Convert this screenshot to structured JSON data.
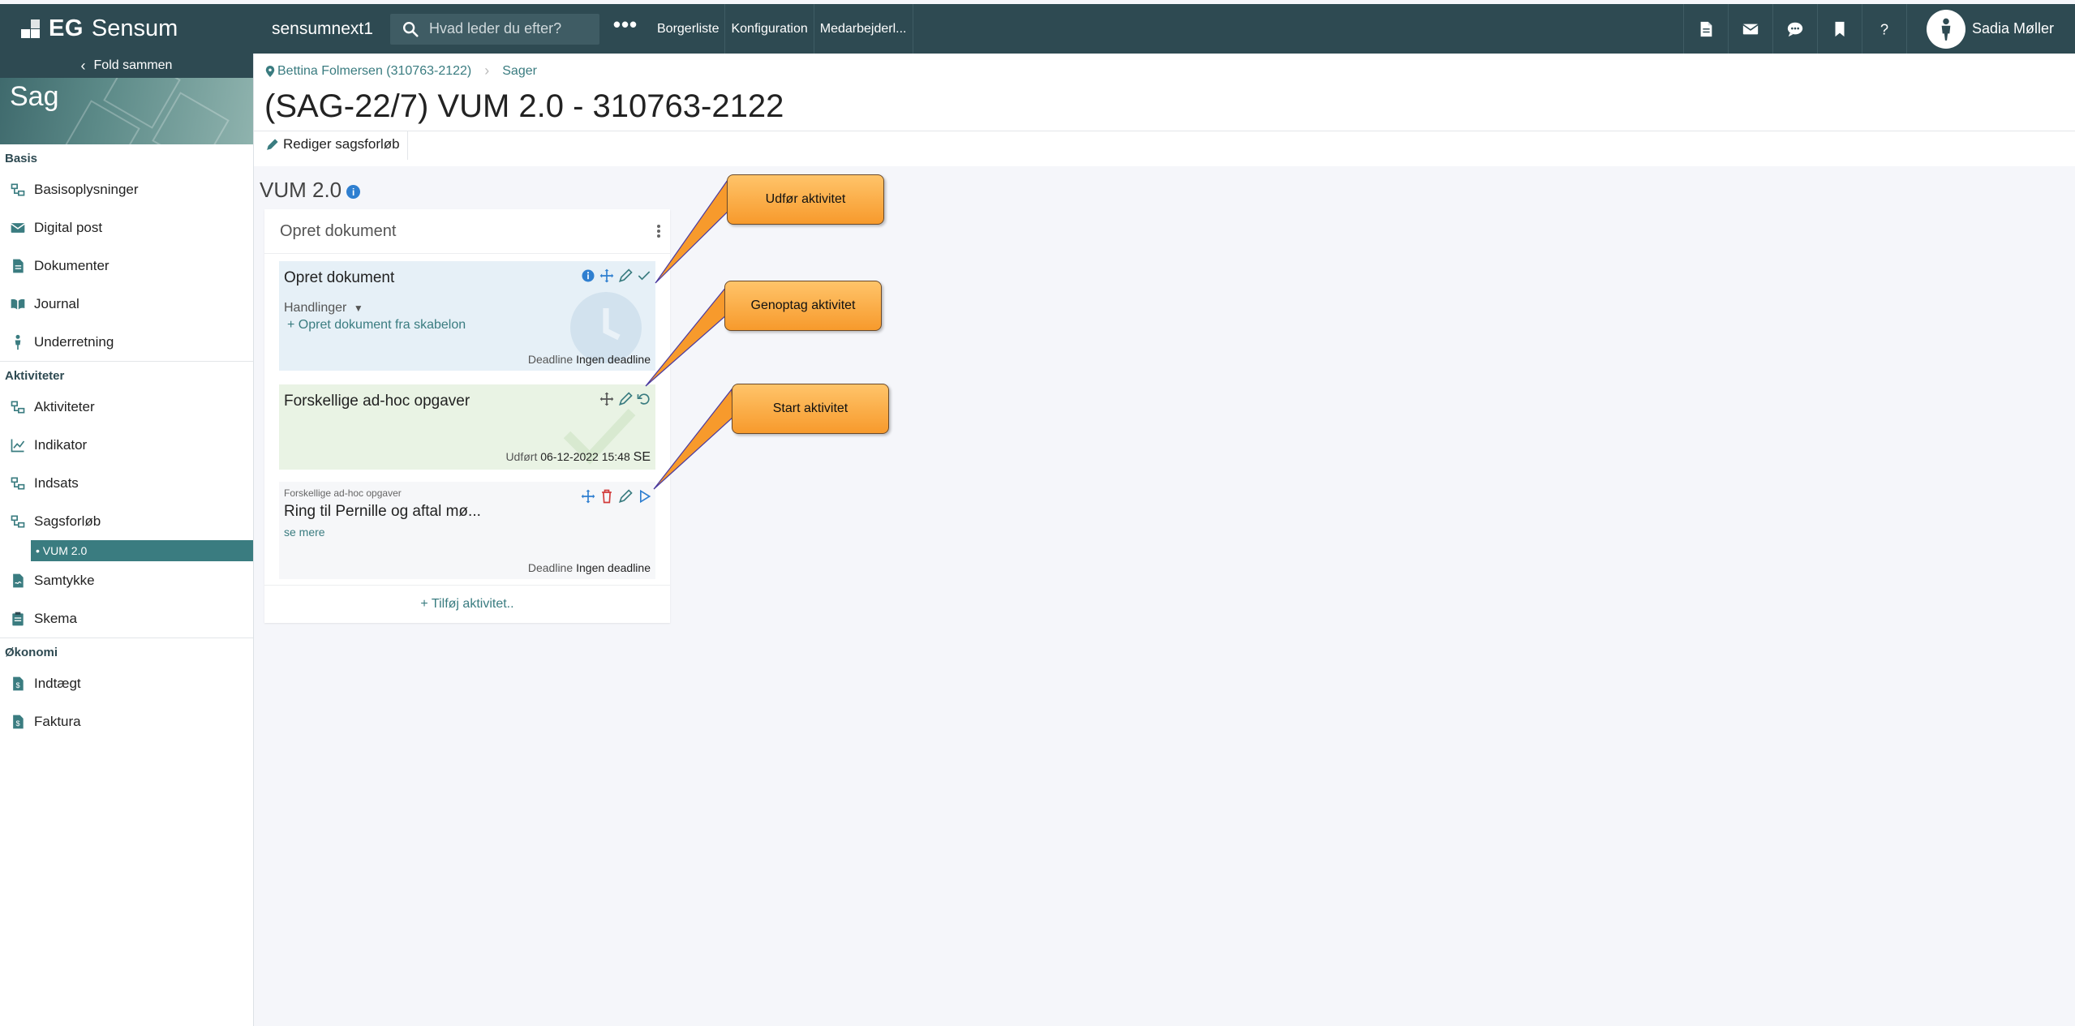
{
  "topbar": {
    "brand": "EG",
    "product": "Sensum",
    "tenant": "sensumnext1",
    "search_placeholder": "Hvad leder du efter?",
    "more": "•••",
    "nav": [
      "Borgerliste",
      "Konfiguration",
      "Medarbejderl..."
    ],
    "user_name": "Sadia Møller"
  },
  "sidebar": {
    "fold_label": "Fold sammen",
    "hero_title": "Sag",
    "sections": [
      {
        "title": "Basis",
        "items": [
          "Basisoplysninger",
          "Digital post",
          "Dokumenter",
          "Journal",
          "Underretning"
        ]
      },
      {
        "title": "Aktiviteter",
        "items": [
          "Aktiviteter",
          "Indikator",
          "Indsats",
          "Sagsforløb"
        ],
        "sub_item": "• VUM 2.0",
        "after": [
          "Samtykke",
          "Skema"
        ]
      },
      {
        "title": "Økonomi",
        "items": [
          "Indtægt",
          "Faktura"
        ]
      }
    ]
  },
  "breadcrumb": {
    "person": "Bettina Folmersen (310763-2122)",
    "section": "Sager"
  },
  "page_title": "(SAG-22/7) VUM 2.0 - 310763-2122",
  "toolbar": {
    "edit_label": "Rediger sagsforløb"
  },
  "flow": {
    "title": "VUM 2.0",
    "column_title": "Opret dokument",
    "cards": [
      {
        "title": "Opret dokument",
        "actions_label": "Handlinger",
        "template_link": "+ Opret dokument fra skabelon",
        "deadline_label": "Deadline",
        "deadline_value": "Ingen deadline"
      },
      {
        "title": "Forskellige ad-hoc opgaver",
        "done_label": "Udført",
        "done_value": "06-12-2022 15:48",
        "done_initials": "SE"
      },
      {
        "subtitle": "Forskellige ad-hoc opgaver",
        "title": "Ring til Pernille og aftal mø...",
        "see_more": "se mere",
        "deadline_label": "Deadline",
        "deadline_value": "Ingen deadline"
      }
    ],
    "add_activity": "+ Tilføj aktivitet.."
  },
  "callouts": [
    "Udfør aktivitet",
    "Genoptag aktivitet",
    "Start aktivitet"
  ],
  "colors": {
    "topbar": "#2e4a52",
    "accent": "#3a7c80",
    "callout": "#f79a2c"
  }
}
